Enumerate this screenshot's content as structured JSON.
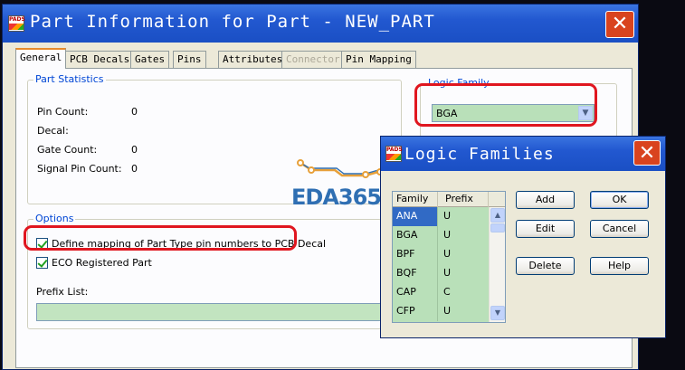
{
  "main": {
    "title": "Part Information for Part - NEW_PART",
    "tabs": [
      "General",
      "PCB Decals",
      "Gates",
      "Pins",
      "Attributes",
      "Connector",
      "Pin Mapping"
    ],
    "part_statistics": {
      "label": "Part Statistics",
      "rows": [
        {
          "label": "Pin Count:",
          "value": "0"
        },
        {
          "label": "Decal:",
          "value": ""
        },
        {
          "label": "Gate Count:",
          "value": "0"
        },
        {
          "label": "Signal Pin Count:",
          "value": "0"
        }
      ]
    },
    "options": {
      "label": "Options",
      "define_mapping": "Define mapping of Part Type pin numbers to PCB Decal",
      "eco_registered": "ECO Registered Part",
      "prefix_list_label": "Prefix List:"
    },
    "logic_family": {
      "label": "Logic Family",
      "value": "BGA"
    }
  },
  "watermark": "EDA365",
  "logic_families": {
    "title": "Logic Families",
    "columns": [
      "Family",
      "Prefix"
    ],
    "rows": [
      {
        "family": "ANA",
        "prefix": "U"
      },
      {
        "family": "BGA",
        "prefix": "U"
      },
      {
        "family": "BPF",
        "prefix": "U"
      },
      {
        "family": "BQF",
        "prefix": "U"
      },
      {
        "family": "CAP",
        "prefix": "C"
      },
      {
        "family": "CFP",
        "prefix": "U"
      }
    ],
    "buttons": {
      "add": "Add",
      "ok": "OK",
      "edit": "Edit",
      "cancel": "Cancel",
      "delete": "Delete",
      "help": "Help"
    }
  },
  "colors": {
    "titlebar": "#2258d0",
    "close": "#d9431e",
    "highlight": "#e0161f",
    "list_bg": "#b9e0b9"
  }
}
